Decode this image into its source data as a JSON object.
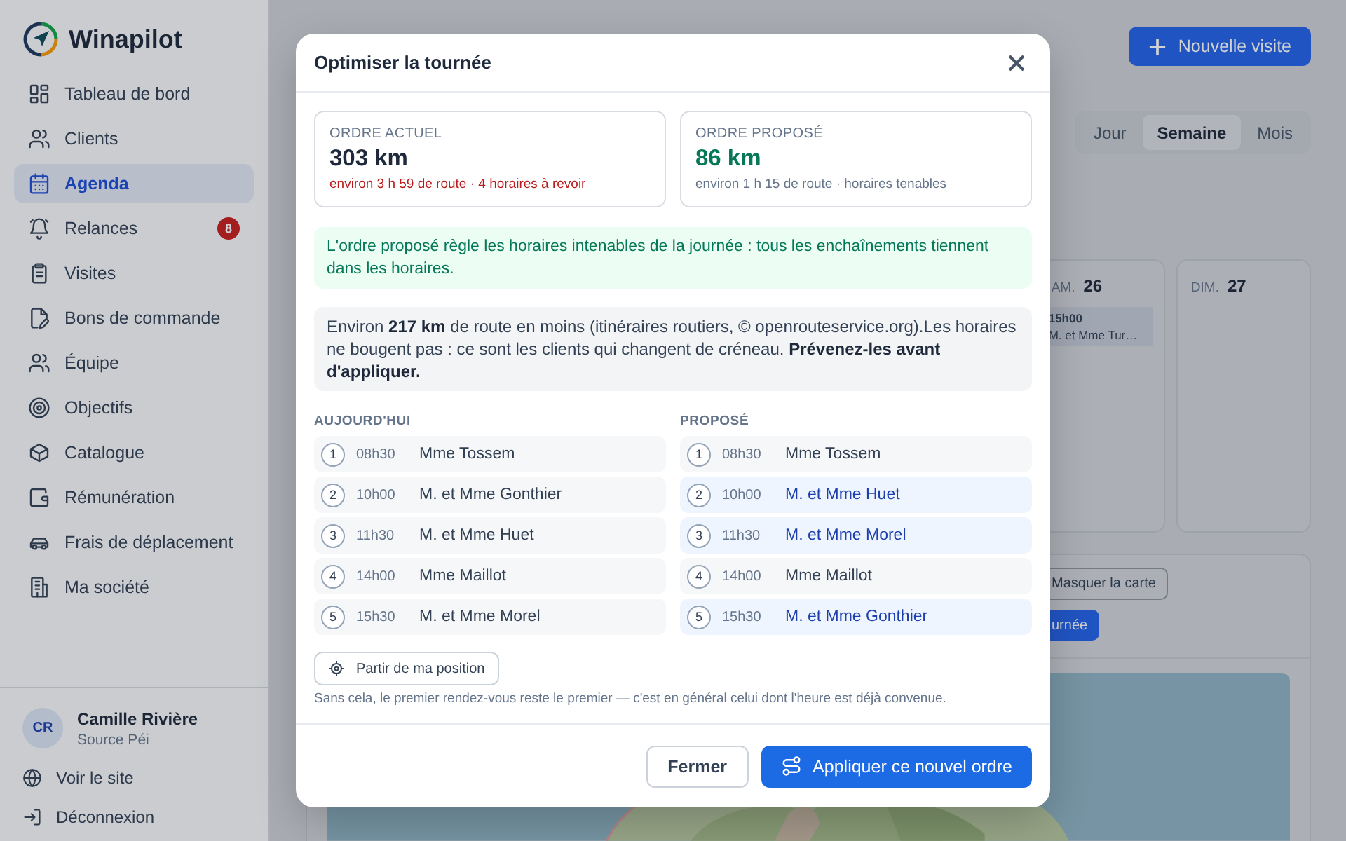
{
  "sidebar": {
    "brand": "Winapilot",
    "items": [
      {
        "label": "Tableau de bord",
        "selected": false
      },
      {
        "label": "Clients",
        "selected": false
      },
      {
        "label": "Agenda",
        "selected": true
      },
      {
        "label": "Relances",
        "selected": false,
        "badge": "8"
      },
      {
        "label": "Visites",
        "selected": false
      },
      {
        "label": "Bons de commande",
        "selected": false
      },
      {
        "label": "Équipe",
        "selected": false
      },
      {
        "label": "Objectifs",
        "selected": false
      },
      {
        "label": "Catalogue",
        "selected": false
      },
      {
        "label": "Rémunération",
        "selected": false
      },
      {
        "label": "Frais de déplacement",
        "selected": false
      },
      {
        "label": "Ma société",
        "selected": false
      }
    ],
    "user": {
      "initials": "CR",
      "name": "Camille Rivière",
      "company": "Source Péi"
    },
    "footer_links": [
      "Voir le site",
      "Déconnexion"
    ]
  },
  "main": {
    "new_visit_button": "Nouvelle visite",
    "view_tabs": [
      {
        "label": "Jour",
        "selected": false
      },
      {
        "label": "Semaine",
        "selected": true
      },
      {
        "label": "Mois",
        "selected": false
      }
    ],
    "days": [
      {
        "weekday": "AM.",
        "date": "26",
        "events": [
          {
            "time": "15h00",
            "client": "M. et Mme Tur…"
          }
        ]
      },
      {
        "weekday": "DIM.",
        "date": "27"
      }
    ],
    "map_panel": {
      "buttons": [
        {
          "label": "Masquer la carte",
          "kind": "outline"
        },
        {
          "label": "urnée",
          "kind": "primary"
        }
      ]
    }
  },
  "dialog": {
    "title": "Optimiser la tournée",
    "summary": [
      {
        "kind": "current",
        "label": "ORDRE ACTUEL",
        "value": "303 km",
        "detail": "environ 3 h 59 de route · 4 horaires à revoir"
      },
      {
        "kind": "proposed",
        "label": "ORDRE PROPOSÉ",
        "value": "86 km",
        "detail": "environ 1 h 15 de route · horaires tenables"
      }
    ],
    "success_note": "L'ordre proposé règle les horaires intenables de la journée : tous les enchaînements tiennent dans les horaires.",
    "info": "Environ **217 km** de route en moins (itinéraires routiers, © openrouteservice.org).Les horaires ne bougent pas : ce sont les clients qui changent de créneau. **Prévenez-les avant d'appliquer.**",
    "columns": [
      {
        "heading": "AUJOURD'HUI",
        "rows": [
          {
            "number": "1",
            "time": "08h30",
            "client": "Mme Tossem",
            "changed": false
          },
          {
            "number": "2",
            "time": "10h00",
            "client": "M. et Mme Gonthier",
            "changed": false
          },
          {
            "number": "3",
            "time": "11h30",
            "client": "M. et Mme Huet",
            "changed": false
          },
          {
            "number": "4",
            "time": "14h00",
            "client": "Mme Maillot",
            "changed": false
          },
          {
            "number": "5",
            "time": "15h30",
            "client": "M. et Mme Morel",
            "changed": false
          }
        ]
      },
      {
        "heading": "PROPOSÉ",
        "rows": [
          {
            "number": "1",
            "time": "08h30",
            "client": "Mme Tossem",
            "changed": false
          },
          {
            "number": "2",
            "time": "10h00",
            "client": "M. et Mme Huet",
            "changed": true
          },
          {
            "number": "3",
            "time": "11h30",
            "client": "M. et Mme Morel",
            "changed": true
          },
          {
            "number": "4",
            "time": "14h00",
            "client": "Mme Maillot",
            "changed": false
          },
          {
            "number": "5",
            "time": "15h30",
            "client": "M. et Mme Gonthier",
            "changed": true
          }
        ]
      }
    ],
    "start_button": "Partir de ma position",
    "hint": "Sans cela, le premier rendez-vous reste le premier — c'est en général celui dont l'heure est déjà convenue.",
    "buttons": [
      {
        "label": "Fermer",
        "kind": "secondary"
      },
      {
        "label": "Appliquer ce nouvel ordre",
        "kind": "primary"
      }
    ]
  }
}
